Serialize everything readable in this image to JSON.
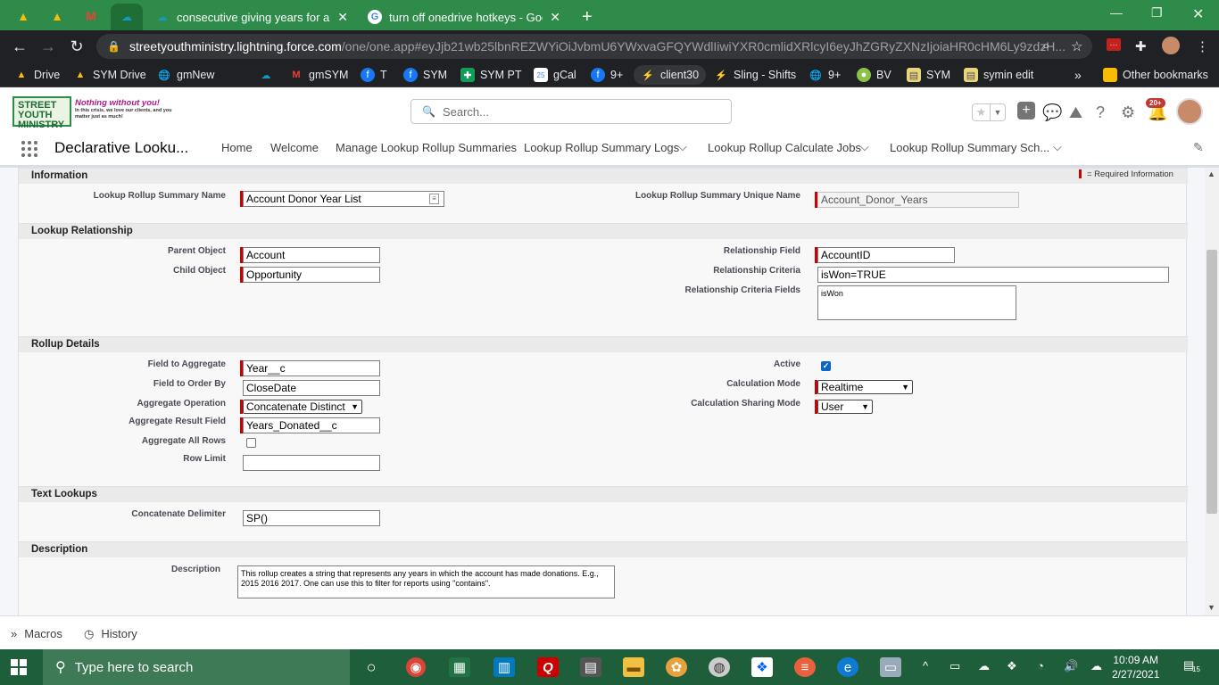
{
  "browser": {
    "tabs": [
      {
        "title": "consecutive giving years for annu",
        "close": "✕"
      },
      {
        "title": "turn off onedrive hotkeys - Goog",
        "close": "✕"
      }
    ],
    "new_tab": "+",
    "url_host": "streetyouthministry.lightning.force.com",
    "url_path": "/one/one.app#eyJjb21wb25lbnREZWYiOiJvbmU6YWxvaGFQYWdlIiwiYXR0cmlidXRlcyI6eyJhZGRyZXNzIjoiaHR0cHM6Ly9zdzH...",
    "bookmarks": [
      {
        "label": "Drive"
      },
      {
        "label": "SYM Drive"
      },
      {
        "label": "gmNew"
      },
      {
        "label": "gmSYM"
      },
      {
        "label": "T"
      },
      {
        "label": "SYM"
      },
      {
        "label": "SYM PT"
      },
      {
        "label": "gCal"
      },
      {
        "label": "9+"
      },
      {
        "label": "client30"
      },
      {
        "label": "Sling - Shifts"
      },
      {
        "label": "9+"
      },
      {
        "label": "BV"
      },
      {
        "label": "SYM"
      },
      {
        "label": "symin edit"
      }
    ],
    "bookmarks_overflow": "»",
    "other_bookmarks": "Other bookmarks"
  },
  "org": {
    "logo_text": "STREET YOUTH MINISTRY",
    "tagline_main": "Nothing without you!",
    "tagline_sub": "In this crisis, we love our clients, and you matter just as much!"
  },
  "header": {
    "search_placeholder": "Search...",
    "notification_count": "20+"
  },
  "app": {
    "name": "Declarative Looku...",
    "nav": [
      {
        "label": "Home"
      },
      {
        "label": "Welcome"
      },
      {
        "label": "Manage Lookup Rollup Summaries"
      },
      {
        "label": "Lookup Rollup Summary Logs"
      },
      {
        "label": "Lookup Rollup Calculate Jobs"
      },
      {
        "label": "Lookup Rollup Summary Sch..."
      }
    ]
  },
  "form": {
    "required_legend": "= Required Information",
    "sections": {
      "information": "Information",
      "lookup_relationship": "Lookup Relationship",
      "rollup_details": "Rollup Details",
      "text_lookups": "Text Lookups",
      "description": "Description"
    },
    "fields": {
      "summary_name": {
        "label": "Lookup Rollup Summary Name",
        "value": "Account Donor Year List"
      },
      "unique_name": {
        "label": "Lookup Rollup Summary Unique Name",
        "value": "Account_Donor_Years"
      },
      "parent_object": {
        "label": "Parent Object",
        "value": "Account"
      },
      "child_object": {
        "label": "Child Object",
        "value": "Opportunity"
      },
      "relationship_field": {
        "label": "Relationship Field",
        "value": "AccountID"
      },
      "relationship_criteria": {
        "label": "Relationship Criteria",
        "value": "isWon=TRUE"
      },
      "relationship_criteria_fields": {
        "label": "Relationship Criteria Fields",
        "value": "isWon"
      },
      "field_to_aggregate": {
        "label": "Field to Aggregate",
        "value": "Year__c"
      },
      "field_to_order_by": {
        "label": "Field to Order By",
        "value": "CloseDate"
      },
      "aggregate_operation": {
        "label": "Aggregate Operation",
        "value": "Concatenate Distinct"
      },
      "aggregate_result_field": {
        "label": "Aggregate Result Field",
        "value": "Years_Donated__c"
      },
      "aggregate_all_rows": {
        "label": "Aggregate All Rows",
        "checked": false
      },
      "row_limit": {
        "label": "Row Limit",
        "value": ""
      },
      "active": {
        "label": "Active",
        "checked": true
      },
      "calculation_mode": {
        "label": "Calculation Mode",
        "value": "Realtime"
      },
      "calculation_sharing_mode": {
        "label": "Calculation Sharing Mode",
        "value": "User"
      },
      "concatenate_delimiter": {
        "label": "Concatenate Delimiter",
        "value": "SP()"
      },
      "description": {
        "label": "Description",
        "value": "This rollup creates a string that represents any years in which the account has made donations. E.g., 2015 2016 2017. One can use this to filter for reports using \"contains\"."
      }
    }
  },
  "utility": {
    "macros": "Macros",
    "history": "History"
  },
  "taskbar": {
    "search_placeholder": "Type here to search",
    "time": "10:09 AM",
    "date": "2/27/2021",
    "notif_count": "15"
  }
}
